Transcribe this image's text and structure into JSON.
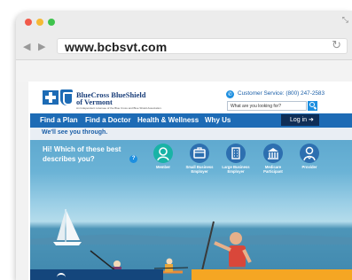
{
  "browser": {
    "url": "www.bcbsvt.com",
    "window_controls": [
      "close",
      "minimize",
      "zoom"
    ],
    "control_colors": [
      "#f15a4a",
      "#f5b935",
      "#3fc34d"
    ]
  },
  "header": {
    "brand_line1": "BlueCross BlueShield",
    "brand_line2": "of Vermont",
    "brand_line3": "An Independent Licensee of the Blue Cross and Blue Shield Association.",
    "customer_service": "Customer Service: (800) 247-2583",
    "search_placeholder": "What are you looking for?"
  },
  "nav": {
    "items": [
      "Find a Plan",
      "Find a Doctor",
      "Health & Wellness",
      "Why Us"
    ],
    "login_label": "Log in"
  },
  "tagline": "We'll see you through.",
  "hero": {
    "question": "Hi! Which of these best describes you?",
    "personas": [
      {
        "label": "Member",
        "icon": "member-icon",
        "color": "#19b3a6"
      },
      {
        "label": "Small Business Employer",
        "icon": "small-business-icon",
        "color": "#2d6fb0"
      },
      {
        "label": "Large Business Employer",
        "icon": "large-business-icon",
        "color": "#2d6fb0"
      },
      {
        "label": "Medicare Participant",
        "icon": "medicare-icon",
        "color": "#2d6fb0"
      },
      {
        "label": "Provider",
        "icon": "provider-icon",
        "color": "#2d6fb0"
      }
    ]
  },
  "colors": {
    "brand_blue": "#1d6bb5",
    "login_navy": "#0f2e57",
    "accent_orange": "#f5a623"
  }
}
